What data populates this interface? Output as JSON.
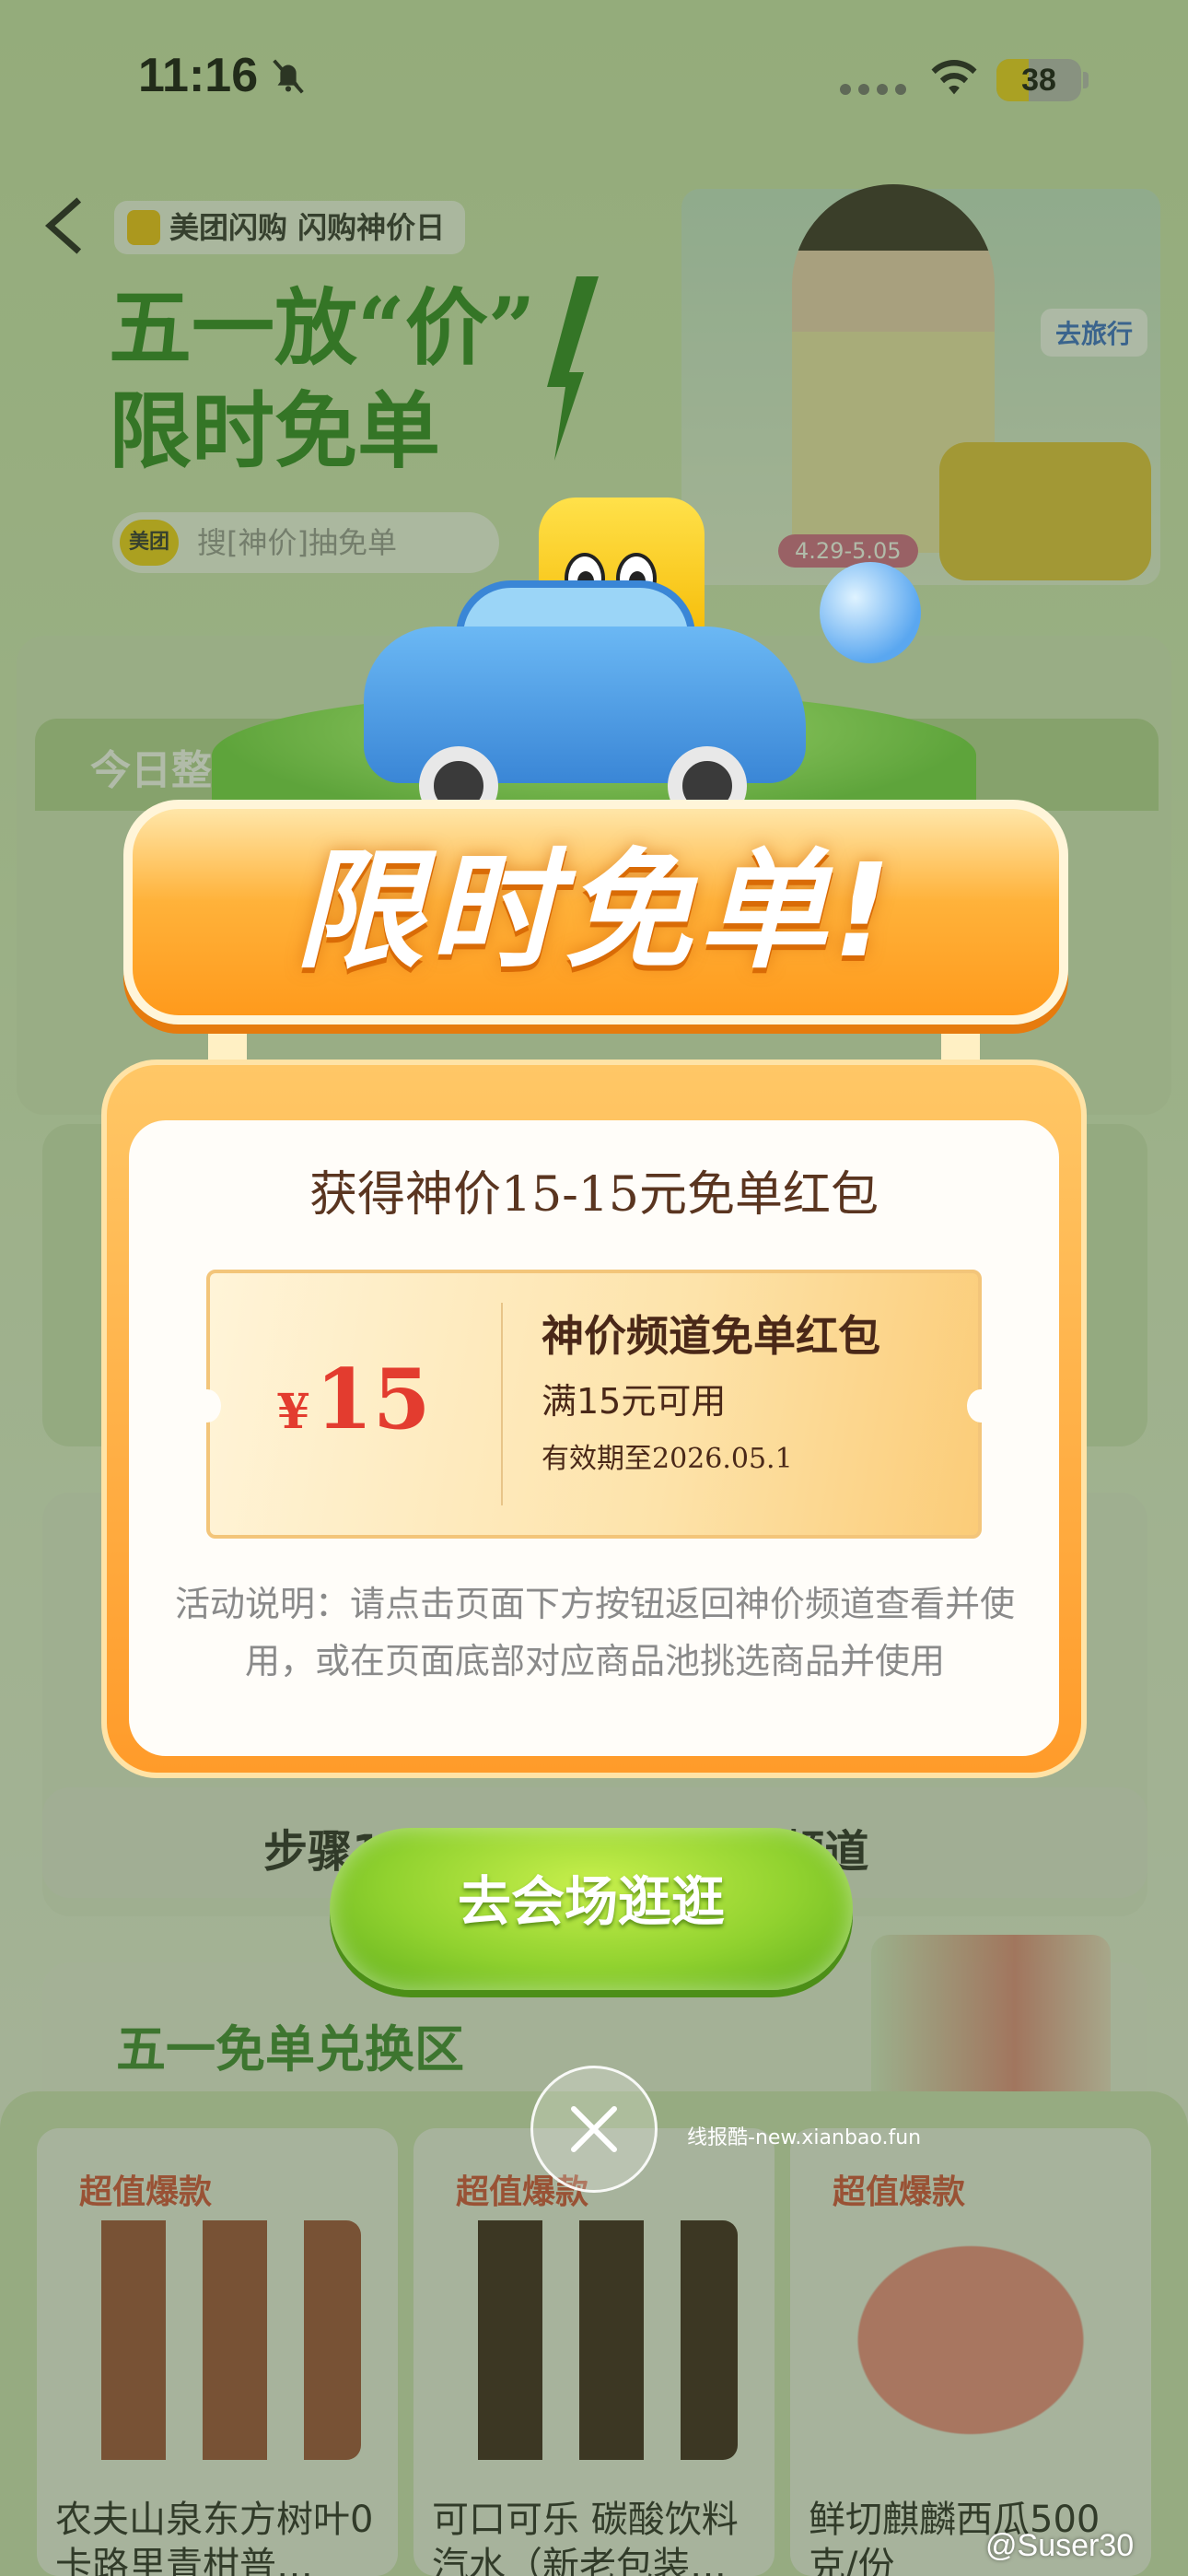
{
  "status_bar": {
    "time": "11:16",
    "battery": "38"
  },
  "hero": {
    "brand": "美团闪购 闪购神价日",
    "headline_line1": "五一放“价”",
    "headline_line2": "限时免单",
    "search_logo": "美团",
    "search_placeholder": "搜[神价]抽免单",
    "travel_tag": "去旅行",
    "date_tag": "4.29-5.05"
  },
  "background": {
    "today_tab": "今日整",
    "step_label": "步骤1：点击此处跳转神价频道",
    "exchange_title": "五一免单兑换区"
  },
  "products": [
    {
      "badge": "超值爆款",
      "name": "农夫山泉东方树叶0卡路里青柑普…"
    },
    {
      "badge": "超值爆款",
      "name": "可口可乐 碳酸饮料汽水（新老包装…"
    },
    {
      "badge": "超值爆款",
      "name": "鲜切麒麟西瓜500克/份"
    }
  ],
  "modal": {
    "title": "限时免单!",
    "subtitle": "获得神价15-15元免单红包",
    "coupon": {
      "currency": "¥",
      "amount": "15",
      "name": "神价频道免单红包",
      "condition": "满15元可用",
      "expiry": "有效期至2026.05.1"
    },
    "note": "活动说明：请点击页面下方按钮返回神价频道查看并使用，或在页面底部对应商品池挑选商品并使用",
    "cta": "去会场逛逛"
  },
  "watermark": "线报酷-new.xianbao.fun",
  "weibo_credit": "@Suser30",
  "colors": {
    "accent_orange": "#ff9b2a",
    "coupon_red": "#e33c2f",
    "cta_green": "#91d22f",
    "headline_green": "#2f8a25"
  }
}
